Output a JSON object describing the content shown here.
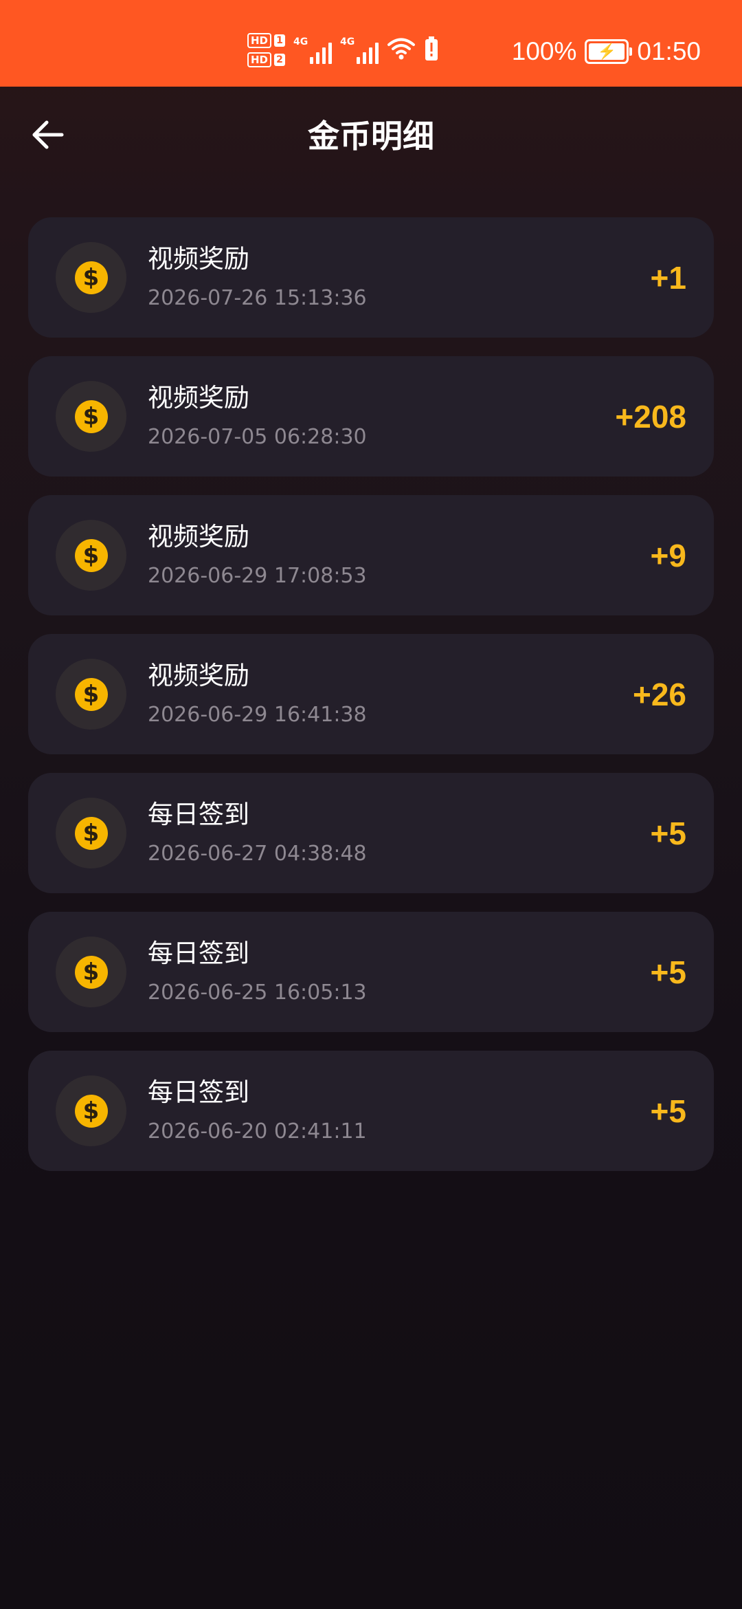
{
  "status_bar": {
    "battery_percent": "100%",
    "time": "01:50",
    "hd1": "HD",
    "hd1_num": "1",
    "hd2": "HD",
    "hd2_num": "2",
    "net1": "4G",
    "net2": "4G",
    "icons": [
      "hd-icon",
      "signal-icon",
      "wifi-icon",
      "battery-alert-icon",
      "battery-charging-icon"
    ],
    "background_color": "#ff5722"
  },
  "header": {
    "title": "金币明细",
    "back_icon": "arrow-left-icon"
  },
  "colors": {
    "accent_amount": "#f8b81c",
    "coin": "#f7b500",
    "card_background": "#241f2a"
  },
  "records": [
    {
      "title": "视频奖励",
      "time": "2026-07-26 15:13:36",
      "amount": "+1",
      "icon": "coin-icon"
    },
    {
      "title": "视频奖励",
      "time": "2026-07-05 06:28:30",
      "amount": "+208",
      "icon": "coin-icon"
    },
    {
      "title": "视频奖励",
      "time": "2026-06-29 17:08:53",
      "amount": "+9",
      "icon": "coin-icon"
    },
    {
      "title": "视频奖励",
      "time": "2026-06-29 16:41:38",
      "amount": "+26",
      "icon": "coin-icon"
    },
    {
      "title": "每日签到",
      "time": "2026-06-27 04:38:48",
      "amount": "+5",
      "icon": "coin-icon"
    },
    {
      "title": "每日签到",
      "time": "2026-06-25 16:05:13",
      "amount": "+5",
      "icon": "coin-icon"
    },
    {
      "title": "每日签到",
      "time": "2026-06-20 02:41:11",
      "amount": "+5",
      "icon": "coin-icon"
    }
  ]
}
